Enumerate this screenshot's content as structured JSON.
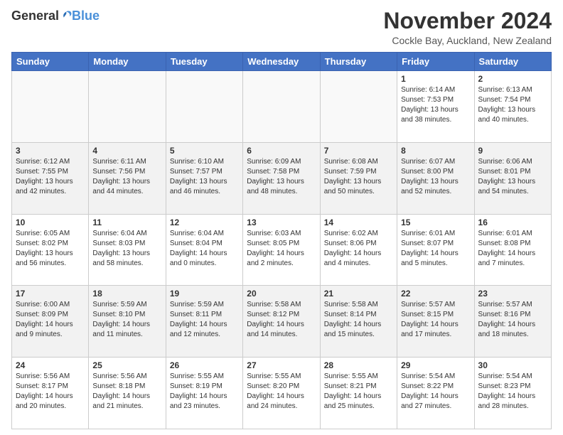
{
  "header": {
    "logo_general": "General",
    "logo_blue": "Blue",
    "month_title": "November 2024",
    "subtitle": "Cockle Bay, Auckland, New Zealand"
  },
  "weekdays": [
    "Sunday",
    "Monday",
    "Tuesday",
    "Wednesday",
    "Thursday",
    "Friday",
    "Saturday"
  ],
  "weeks": [
    [
      {
        "day": "",
        "info": ""
      },
      {
        "day": "",
        "info": ""
      },
      {
        "day": "",
        "info": ""
      },
      {
        "day": "",
        "info": ""
      },
      {
        "day": "",
        "info": ""
      },
      {
        "day": "1",
        "info": "Sunrise: 6:14 AM\nSunset: 7:53 PM\nDaylight: 13 hours\nand 38 minutes."
      },
      {
        "day": "2",
        "info": "Sunrise: 6:13 AM\nSunset: 7:54 PM\nDaylight: 13 hours\nand 40 minutes."
      }
    ],
    [
      {
        "day": "3",
        "info": "Sunrise: 6:12 AM\nSunset: 7:55 PM\nDaylight: 13 hours\nand 42 minutes."
      },
      {
        "day": "4",
        "info": "Sunrise: 6:11 AM\nSunset: 7:56 PM\nDaylight: 13 hours\nand 44 minutes."
      },
      {
        "day": "5",
        "info": "Sunrise: 6:10 AM\nSunset: 7:57 PM\nDaylight: 13 hours\nand 46 minutes."
      },
      {
        "day": "6",
        "info": "Sunrise: 6:09 AM\nSunset: 7:58 PM\nDaylight: 13 hours\nand 48 minutes."
      },
      {
        "day": "7",
        "info": "Sunrise: 6:08 AM\nSunset: 7:59 PM\nDaylight: 13 hours\nand 50 minutes."
      },
      {
        "day": "8",
        "info": "Sunrise: 6:07 AM\nSunset: 8:00 PM\nDaylight: 13 hours\nand 52 minutes."
      },
      {
        "day": "9",
        "info": "Sunrise: 6:06 AM\nSunset: 8:01 PM\nDaylight: 13 hours\nand 54 minutes."
      }
    ],
    [
      {
        "day": "10",
        "info": "Sunrise: 6:05 AM\nSunset: 8:02 PM\nDaylight: 13 hours\nand 56 minutes."
      },
      {
        "day": "11",
        "info": "Sunrise: 6:04 AM\nSunset: 8:03 PM\nDaylight: 13 hours\nand 58 minutes."
      },
      {
        "day": "12",
        "info": "Sunrise: 6:04 AM\nSunset: 8:04 PM\nDaylight: 14 hours\nand 0 minutes."
      },
      {
        "day": "13",
        "info": "Sunrise: 6:03 AM\nSunset: 8:05 PM\nDaylight: 14 hours\nand 2 minutes."
      },
      {
        "day": "14",
        "info": "Sunrise: 6:02 AM\nSunset: 8:06 PM\nDaylight: 14 hours\nand 4 minutes."
      },
      {
        "day": "15",
        "info": "Sunrise: 6:01 AM\nSunset: 8:07 PM\nDaylight: 14 hours\nand 5 minutes."
      },
      {
        "day": "16",
        "info": "Sunrise: 6:01 AM\nSunset: 8:08 PM\nDaylight: 14 hours\nand 7 minutes."
      }
    ],
    [
      {
        "day": "17",
        "info": "Sunrise: 6:00 AM\nSunset: 8:09 PM\nDaylight: 14 hours\nand 9 minutes."
      },
      {
        "day": "18",
        "info": "Sunrise: 5:59 AM\nSunset: 8:10 PM\nDaylight: 14 hours\nand 11 minutes."
      },
      {
        "day": "19",
        "info": "Sunrise: 5:59 AM\nSunset: 8:11 PM\nDaylight: 14 hours\nand 12 minutes."
      },
      {
        "day": "20",
        "info": "Sunrise: 5:58 AM\nSunset: 8:12 PM\nDaylight: 14 hours\nand 14 minutes."
      },
      {
        "day": "21",
        "info": "Sunrise: 5:58 AM\nSunset: 8:14 PM\nDaylight: 14 hours\nand 15 minutes."
      },
      {
        "day": "22",
        "info": "Sunrise: 5:57 AM\nSunset: 8:15 PM\nDaylight: 14 hours\nand 17 minutes."
      },
      {
        "day": "23",
        "info": "Sunrise: 5:57 AM\nSunset: 8:16 PM\nDaylight: 14 hours\nand 18 minutes."
      }
    ],
    [
      {
        "day": "24",
        "info": "Sunrise: 5:56 AM\nSunset: 8:17 PM\nDaylight: 14 hours\nand 20 minutes."
      },
      {
        "day": "25",
        "info": "Sunrise: 5:56 AM\nSunset: 8:18 PM\nDaylight: 14 hours\nand 21 minutes."
      },
      {
        "day": "26",
        "info": "Sunrise: 5:55 AM\nSunset: 8:19 PM\nDaylight: 14 hours\nand 23 minutes."
      },
      {
        "day": "27",
        "info": "Sunrise: 5:55 AM\nSunset: 8:20 PM\nDaylight: 14 hours\nand 24 minutes."
      },
      {
        "day": "28",
        "info": "Sunrise: 5:55 AM\nSunset: 8:21 PM\nDaylight: 14 hours\nand 25 minutes."
      },
      {
        "day": "29",
        "info": "Sunrise: 5:54 AM\nSunset: 8:22 PM\nDaylight: 14 hours\nand 27 minutes."
      },
      {
        "day": "30",
        "info": "Sunrise: 5:54 AM\nSunset: 8:23 PM\nDaylight: 14 hours\nand 28 minutes."
      }
    ]
  ]
}
